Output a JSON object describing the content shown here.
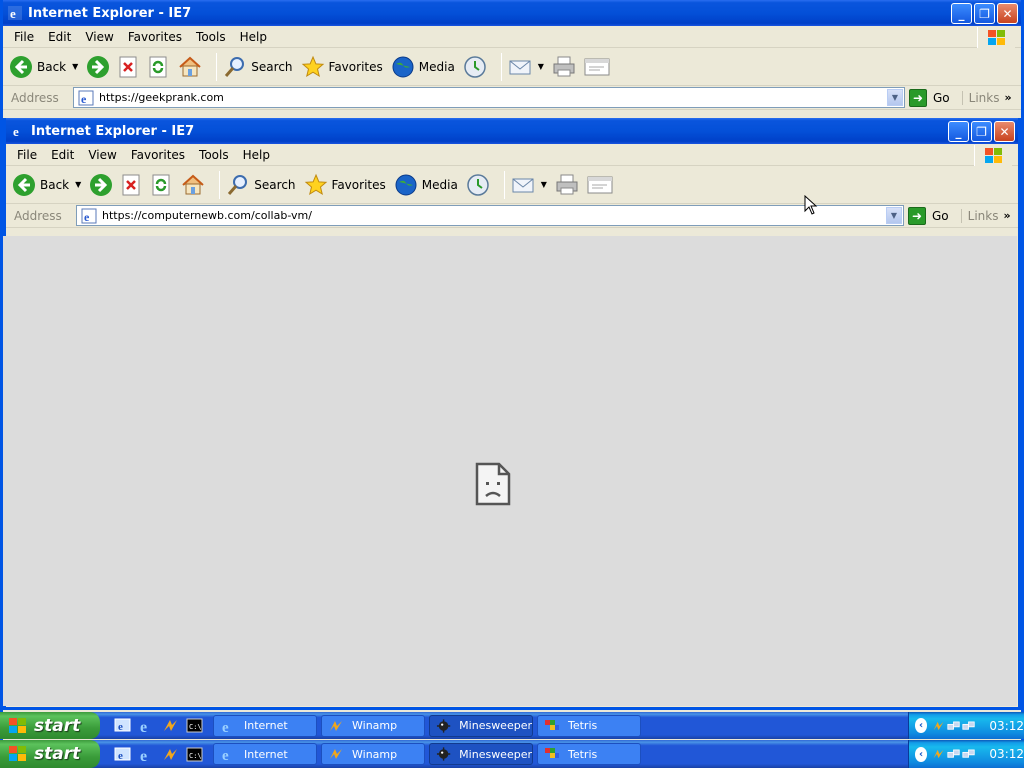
{
  "outer_window": {
    "title": "Internet Explorer - IE7",
    "menu": [
      "File",
      "Edit",
      "View",
      "Favorites",
      "Tools",
      "Help"
    ],
    "toolbar": {
      "back": "Back",
      "search": "Search",
      "favorites": "Favorites",
      "media": "Media"
    },
    "address": {
      "label": "Address",
      "url": "https://geekprank.com",
      "go": "Go",
      "links": "Links"
    }
  },
  "inner_window": {
    "title": "Internet Explorer - IE7",
    "menu": [
      "File",
      "Edit",
      "View",
      "Favorites",
      "Tools",
      "Help"
    ],
    "toolbar": {
      "back": "Back",
      "search": "Search",
      "favorites": "Favorites",
      "media": "Media"
    },
    "address": {
      "label": "Address",
      "url": "https://computernewb.com/collab-vm/",
      "go": "Go",
      "links": "Links"
    }
  },
  "taskbar_top": {
    "start": "start",
    "tasks": [
      "Internet",
      "Winamp",
      "Minesweeper",
      "Tetris"
    ],
    "clock": "03:12"
  },
  "taskbar_bottom": {
    "start": "start",
    "tasks": [
      "Internet",
      "Winamp",
      "Minesweeper",
      "Tetris"
    ],
    "clock": "03:12"
  },
  "icons": {
    "content": "sad-document-icon"
  }
}
